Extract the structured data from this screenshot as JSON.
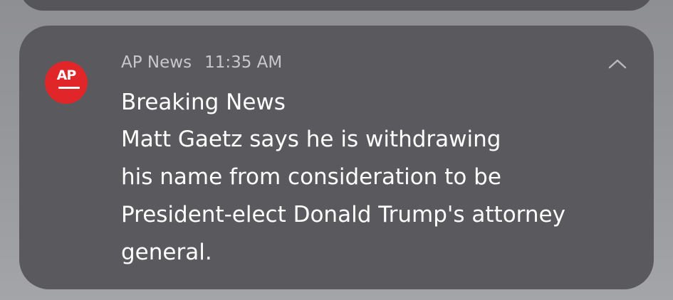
{
  "notification": {
    "app_name": "AP News",
    "time": "11:35 AM",
    "icon_text": "AP",
    "title": "Breaking News",
    "body_lines": [
      "Matt Gaetz says he is withdrawing",
      "his name from consideration to be",
      "President-elect Donald Trump's attorney",
      "general."
    ],
    "icon_color": "#e12629",
    "collapse_icon": "chevron-up-icon"
  }
}
